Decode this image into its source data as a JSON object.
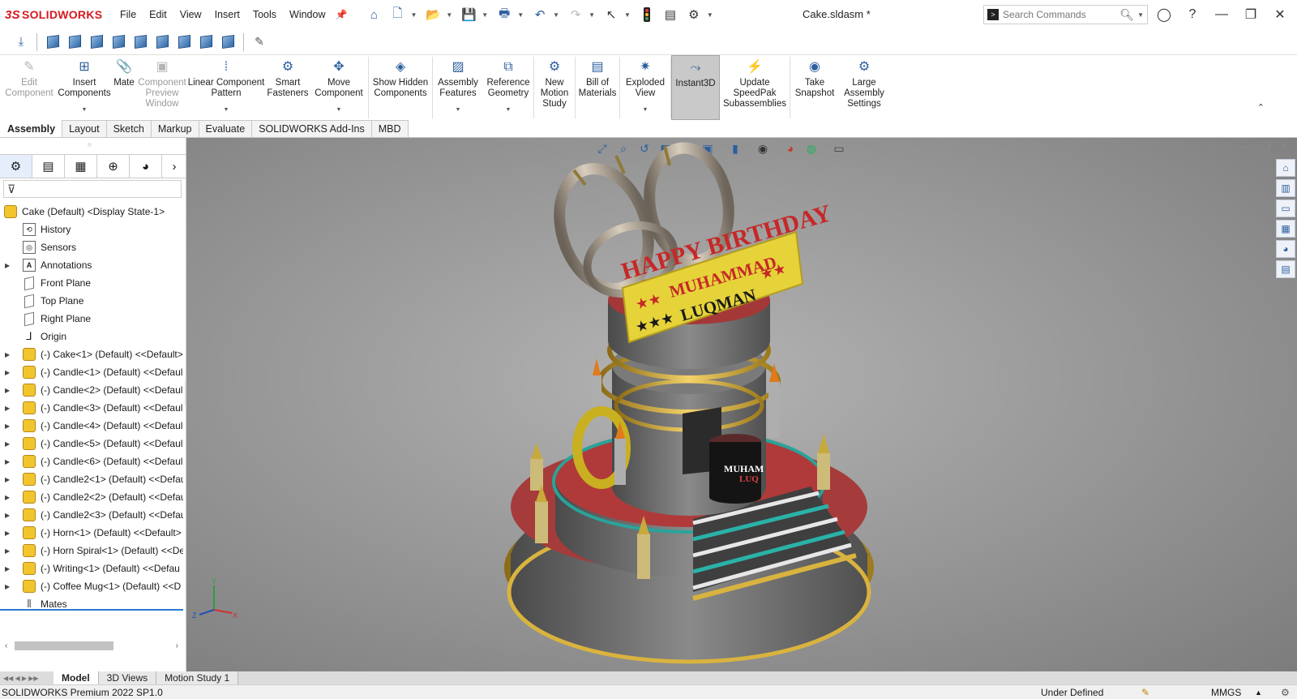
{
  "app": {
    "brand": "SOLIDWORKS",
    "document_title": "Cake.sldasm *",
    "accent": "#d71920"
  },
  "menu": [
    "File",
    "Edit",
    "View",
    "Insert",
    "Tools",
    "Window"
  ],
  "search": {
    "placeholder": "Search Commands"
  },
  "commands": [
    {
      "label": "Edit Component",
      "disabled": true,
      "icon": "edit-component-icon"
    },
    {
      "label": "Insert Components",
      "icon": "insert-components-icon",
      "dropdown": true
    },
    {
      "label": "Mate",
      "icon": "mate-icon"
    },
    {
      "label": "Component Preview Window",
      "disabled": true,
      "icon": "preview-window-icon"
    },
    {
      "label": "Linear Component Pattern",
      "icon": "linear-pattern-icon",
      "dropdown": true
    },
    {
      "label": "Smart Fasteners",
      "icon": "smart-fasteners-icon"
    },
    {
      "label": "Move Component",
      "icon": "move-component-icon",
      "dropdown": true
    },
    {
      "label": "Show Hidden Components",
      "icon": "show-hidden-icon"
    },
    {
      "label": "Assembly Features",
      "icon": "assembly-features-icon",
      "dropdown": true
    },
    {
      "label": "Reference Geometry",
      "icon": "reference-geometry-icon",
      "dropdown": true
    },
    {
      "label": "New Motion Study",
      "icon": "motion-study-icon"
    },
    {
      "label": "Bill of Materials",
      "icon": "bom-icon"
    },
    {
      "label": "Exploded View",
      "icon": "exploded-view-icon",
      "dropdown": true
    },
    {
      "label": "Instant3D",
      "icon": "instant3d-icon",
      "active": true
    },
    {
      "label": "Update SpeedPak Subassemblies",
      "icon": "speedpak-icon"
    },
    {
      "label": "Take Snapshot",
      "icon": "snapshot-icon"
    },
    {
      "label": "Large Assembly Settings",
      "icon": "large-assembly-icon"
    }
  ],
  "cmd_tabs": [
    "Assembly",
    "Layout",
    "Sketch",
    "Markup",
    "Evaluate",
    "SOLIDWORKS Add-Ins",
    "MBD"
  ],
  "tree": {
    "root": "Cake (Default) <Display State-1>",
    "items": [
      {
        "label": "History",
        "icon": "history-icon",
        "expand": false
      },
      {
        "label": "Sensors",
        "icon": "sensors-icon",
        "expand": false
      },
      {
        "label": "Annotations",
        "icon": "annotations-icon",
        "expand": true
      },
      {
        "label": "Front Plane",
        "icon": "plane-icon",
        "expand": false
      },
      {
        "label": "Top Plane",
        "icon": "plane-icon",
        "expand": false
      },
      {
        "label": "Right Plane",
        "icon": "plane-icon",
        "expand": false
      },
      {
        "label": "Origin",
        "icon": "origin-icon",
        "expand": false
      },
      {
        "label": "(-) Cake<1> (Default) <<Default>",
        "icon": "part-icon",
        "expand": true
      },
      {
        "label": "(-) Candle<1> (Default) <<Defaul",
        "icon": "part-icon",
        "expand": true
      },
      {
        "label": "(-) Candle<2> (Default) <<Defaul",
        "icon": "part-icon",
        "expand": true
      },
      {
        "label": "(-) Candle<3> (Default) <<Defaul",
        "icon": "part-icon",
        "expand": true
      },
      {
        "label": "(-) Candle<4> (Default) <<Defaul",
        "icon": "part-icon",
        "expand": true
      },
      {
        "label": "(-) Candle<5> (Default) <<Defaul",
        "icon": "part-icon",
        "expand": true
      },
      {
        "label": "(-) Candle<6> (Default) <<Defaul",
        "icon": "part-icon",
        "expand": true
      },
      {
        "label": "(-) Candle2<1> (Default) <<Defau",
        "icon": "part-icon",
        "expand": true
      },
      {
        "label": "(-) Candle2<2> (Default) <<Defau",
        "icon": "part-icon",
        "expand": true
      },
      {
        "label": "(-) Candle2<3> (Default) <<Defau",
        "icon": "part-icon",
        "expand": true
      },
      {
        "label": "(-) Horn<1> (Default) <<Default>",
        "icon": "part-icon",
        "expand": true
      },
      {
        "label": "(-) Horn Spiral<1> (Default) <<De",
        "icon": "part-icon",
        "expand": true
      },
      {
        "label": "(-) Writing<1> (Default) <<Defau",
        "icon": "part-icon",
        "expand": true
      },
      {
        "label": "(-) Coffee Mug<1> (Default) <<D",
        "icon": "part-icon",
        "expand": true
      },
      {
        "label": "Mates",
        "icon": "mates-icon",
        "expand": false
      }
    ]
  },
  "model": {
    "banner_lines": [
      "HAPPY BIRTHDAY",
      "MUHAMMAD",
      "LUQMAN"
    ],
    "mug_text": [
      "MUHAM",
      "LUQ"
    ],
    "triad_labels": [
      "Y",
      "Z",
      "X"
    ]
  },
  "bottom_tabs": [
    "Model",
    "3D Views",
    "Motion Study 1"
  ],
  "status": {
    "version": "SOLIDWORKS Premium 2022 SP1.0",
    "state": "Under Defined",
    "units": "MMGS"
  }
}
